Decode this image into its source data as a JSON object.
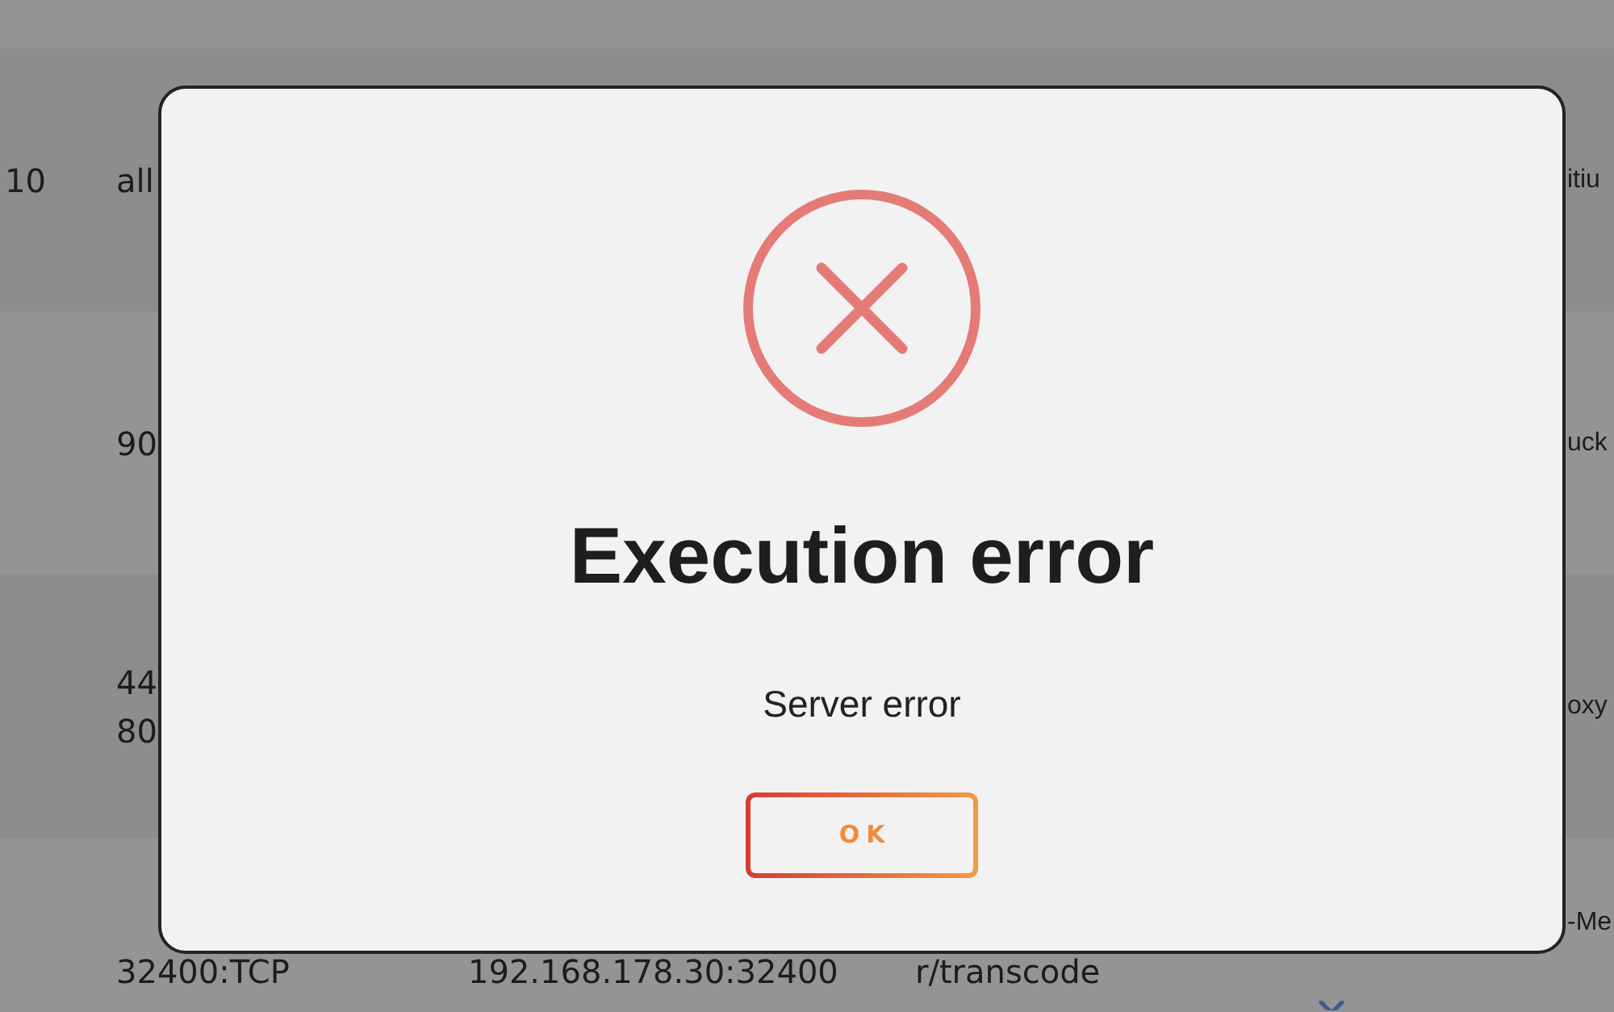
{
  "background_table": {
    "rows": [
      {
        "column_1": "10",
        "column_2": "all",
        "column_5": "itiu"
      },
      {
        "column_2": "90",
        "column_5": "uck"
      },
      {
        "column_2": [
          "44",
          "80"
        ],
        "column_5": "oxy"
      },
      {
        "column_2": "32400:TCP",
        "column_3": "192.168.178.30:32400",
        "column_4": "r/transcode",
        "column_5": "-Me"
      }
    ]
  },
  "dialog": {
    "kind": "error",
    "title": "Execution error",
    "message": "Server error",
    "buttons": [
      {
        "label": "OK"
      }
    ]
  }
}
